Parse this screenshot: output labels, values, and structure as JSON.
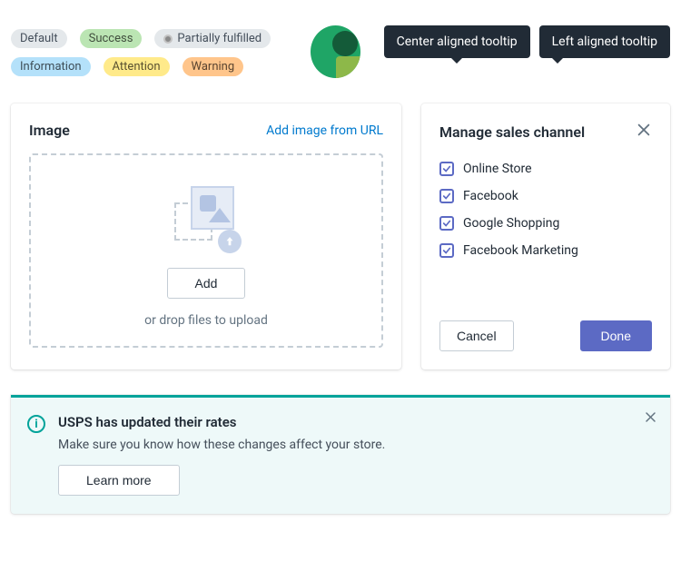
{
  "badges": {
    "default": "Default",
    "success": "Success",
    "partially_fulfilled": "Partially fulfilled",
    "information": "Information",
    "attention": "Attention",
    "warning": "Warning"
  },
  "tooltips": {
    "center": "Center aligned tooltip",
    "left": "Left aligned tooltip"
  },
  "image_card": {
    "title": "Image",
    "add_from_url": "Add image from URL",
    "add_button": "Add",
    "drop_hint": "or drop files to upload"
  },
  "channels": {
    "title": "Manage sales channel",
    "items": [
      {
        "label": "Online Store",
        "checked": true
      },
      {
        "label": "Facebook",
        "checked": true
      },
      {
        "label": "Google Shopping",
        "checked": true
      },
      {
        "label": "Facebook Marketing",
        "checked": true
      }
    ],
    "cancel": "Cancel",
    "done": "Done"
  },
  "banner": {
    "title": "USPS has updated their rates",
    "text": "Make sure you know how these changes affect your store.",
    "action": "Learn more"
  }
}
